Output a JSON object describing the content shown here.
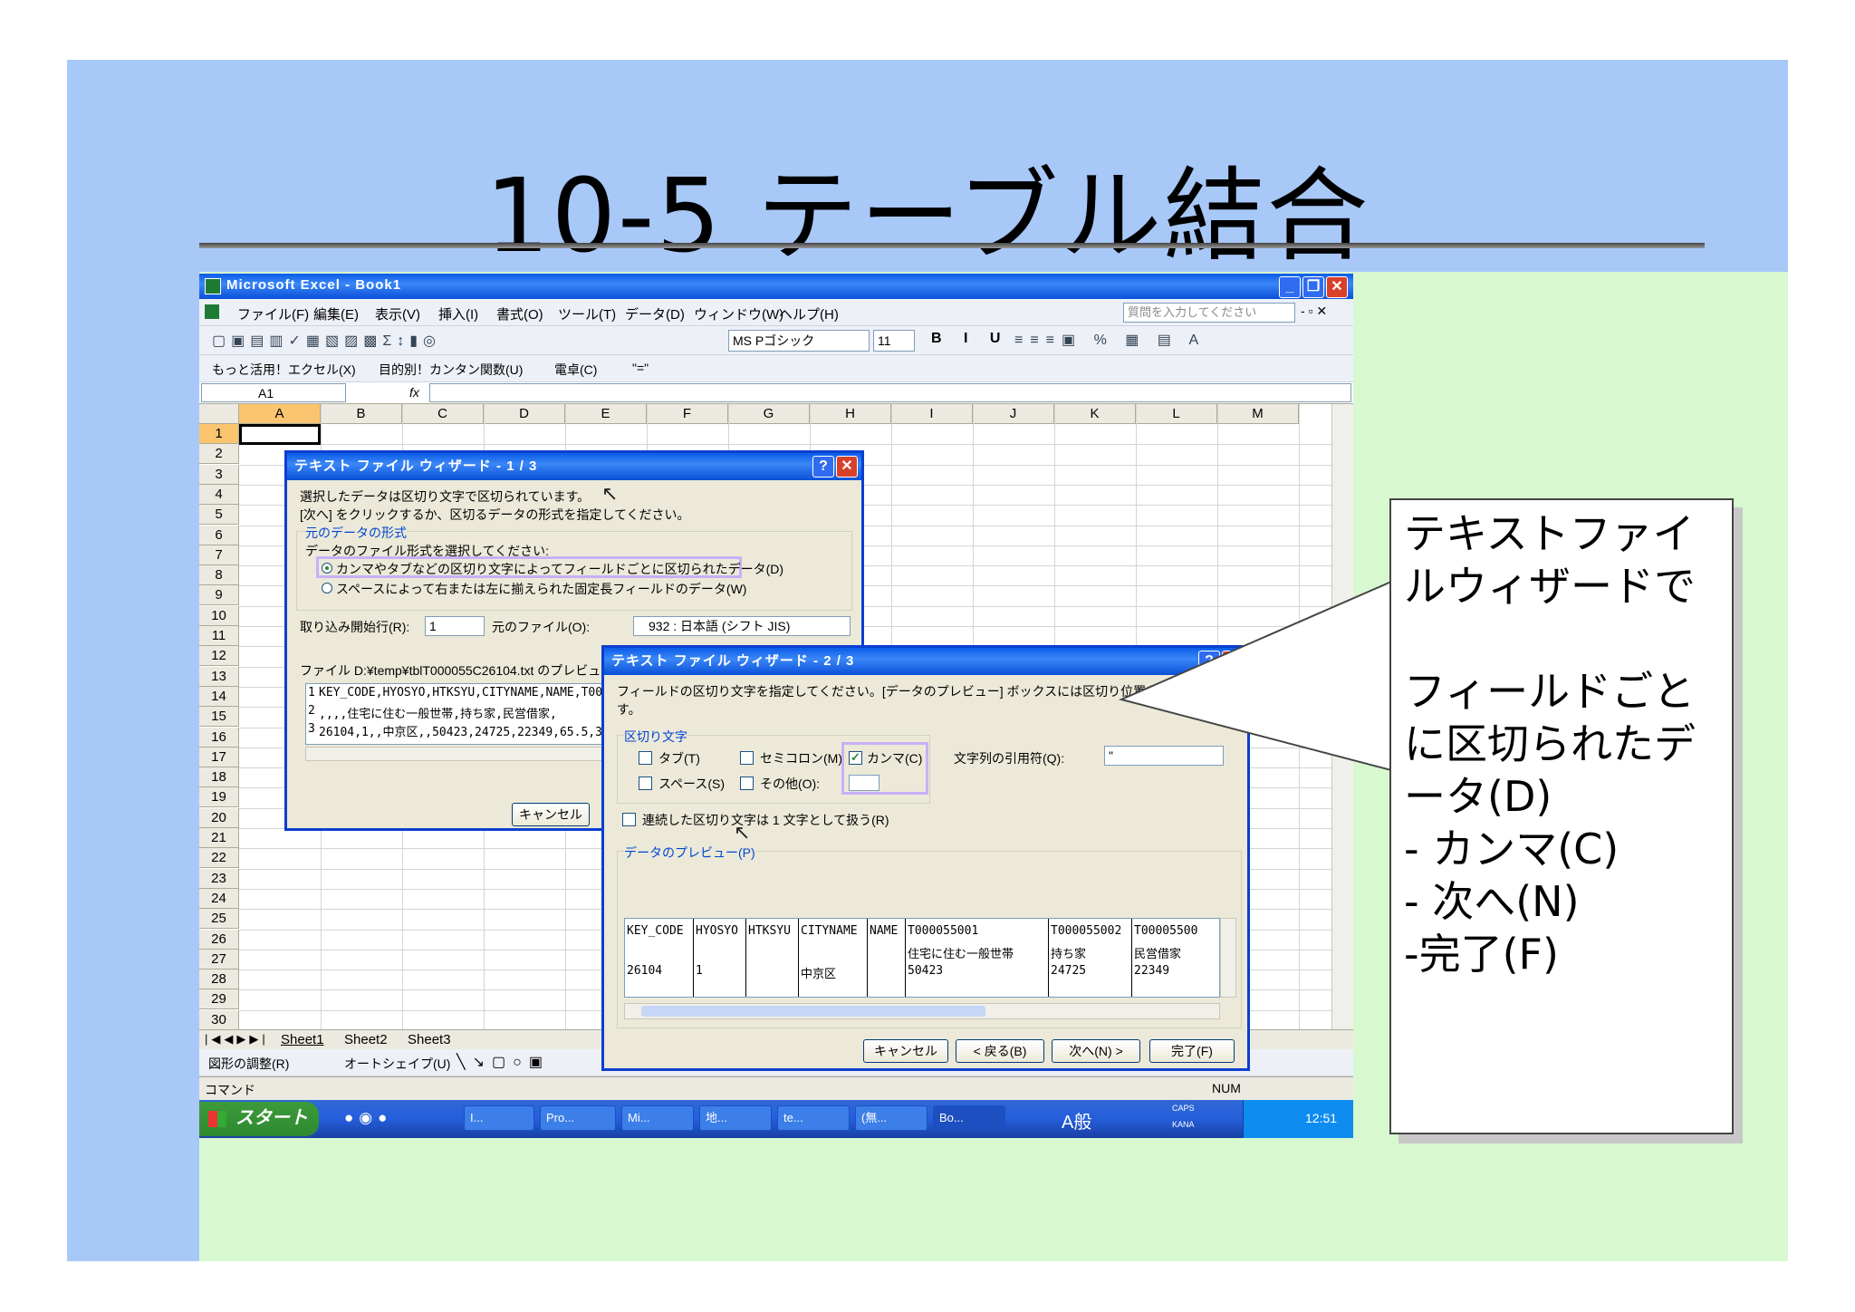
{
  "slide": {
    "title": "10-5 テーブル結合"
  },
  "excel": {
    "window_title": "Microsoft Excel - Book1",
    "menu": [
      "ファイル(F)",
      "編集(E)",
      "表示(V)",
      "挿入(I)",
      "書式(O)",
      "ツール(T)",
      "データ(D)",
      "ウィンドウ(W)",
      "ヘルプ(H)"
    ],
    "help_box": "質問を入力してください",
    "font_name": "MS Pゴシック",
    "font_size": "11",
    "toolbar3": [
      "もっと活用！エクセル(X)",
      "目的別！カンタン関数(U)",
      "電卓(C)",
      "\"=\""
    ],
    "name_box": "A1",
    "fx": "fx",
    "columns": [
      "A",
      "B",
      "C",
      "D",
      "E",
      "F",
      "G",
      "H",
      "I",
      "J",
      "K",
      "L",
      "M"
    ],
    "rows": [
      "1",
      "2",
      "3",
      "4",
      "5",
      "6",
      "7",
      "8",
      "9",
      "10",
      "11",
      "12",
      "13",
      "14",
      "15",
      "16",
      "17",
      "18",
      "19",
      "20",
      "21",
      "22",
      "23",
      "24",
      "25",
      "26",
      "27",
      "28",
      "29",
      "30"
    ],
    "sheets": [
      "Sheet1",
      "Sheet2",
      "Sheet3"
    ],
    "drawing_bar": [
      "図形の調整(R)",
      "オートシェイプ(U)"
    ],
    "status_left": "コマンド",
    "status_right": "NUM"
  },
  "wizard1": {
    "title": "テキスト ファイル ウィザード - 1 / 3",
    "line1": "選択したデータは区切り文字で区切られています。",
    "line2": "[次へ] をクリックするか、区切るデータの形式を指定してください。",
    "group": "元のデータの形式",
    "prompt": "データのファイル形式を選択してください:",
    "opt1": "カンマやタブなどの区切り文字によってフィールドごとに区切られたデータ(D)",
    "opt2": "スペースによって右または左に揃えられた固定長フィールドのデータ(W)",
    "start_row_label": "取り込み開始行(R):",
    "start_row": "1",
    "origin_label": "元のファイル(O):",
    "origin": "932 : 日本語 (シフト JIS)",
    "preview_label": "ファイル D:¥temp¥tblT000055C26104.txt のプレビュー",
    "preview_lines": [
      "KEY_CODE,HYOSYO,HTKSYU,CITYNAME,NAME,T000",
      "",
      ",,,,住宅に住む一般世帯,持ち家,民営借家,",
      "26104,1,,中京区,,50423,24725,22349,65.5,3"
    ],
    "preview_nums": [
      "1",
      "2",
      "3"
    ],
    "cancel": "キャンセル"
  },
  "wizard2": {
    "title": "テキスト ファイル ウィザード - 2 / 3",
    "intro": "フィールドの区切り文字を指定してください。[データのプレビュー] ボックスには区切り位置が表示されます。",
    "intro2": "す。",
    "group": "区切り文字",
    "tab": "タブ(T)",
    "semicolon": "セミコロン(M)",
    "comma": "カンマ(C)",
    "space": "スペース(S)",
    "other": "その他(O):",
    "quote_label": "文字列の引用符(Q):",
    "quote_value": "\"",
    "consecutive": "連続した区切り文字は 1 文字として扱う(R)",
    "preview_group": "データのプレビュー(P)",
    "preview_header": [
      "KEY_CODE",
      "HYOSYO",
      "HTKSYU",
      "CITYNAME",
      "NAME",
      "T000055001",
      "T000055002",
      "T00005500"
    ],
    "preview_row2": [
      "",
      "",
      "",
      "",
      "",
      "住宅に住む一般世帯",
      "持ち家",
      "民営借家"
    ],
    "preview_row3": [
      "26104",
      "1",
      "",
      "中京区",
      "",
      "50423",
      "24725",
      "22349"
    ],
    "cancel": "キャンセル",
    "back": "< 戻る(B)",
    "next": "次へ(N) >",
    "finish": "完了(F)"
  },
  "taskbar": {
    "start": "スタート",
    "tasks": [
      "I...",
      "Pro...",
      "Mi...",
      "地...",
      "te...",
      "(無...",
      "Bo..."
    ],
    "ime": "A般",
    "caps": "CAPS",
    "kana": "KANA",
    "clock": "12:51"
  },
  "callout": {
    "lines": [
      "テキストファイ",
      "ルウィザードで",
      "",
      "フィールドごと",
      "に区切られたデ",
      "ータ(D)",
      " - カンマ(C)",
      " - 次へ(N)",
      " -完了(F)"
    ]
  }
}
